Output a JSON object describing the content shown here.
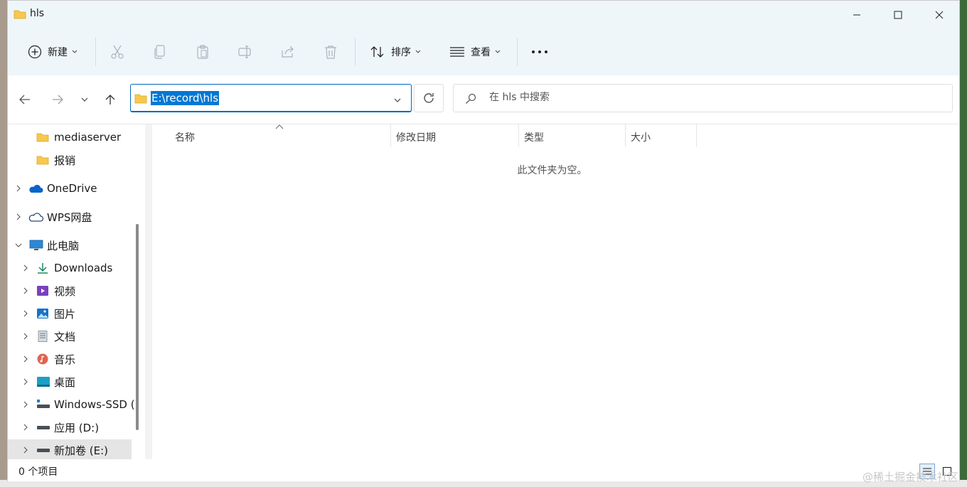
{
  "window": {
    "title": "hls"
  },
  "toolbar": {
    "new_label": "新建",
    "sort_label": "排序",
    "view_label": "查看"
  },
  "address": {
    "path": "E:\\record\\hls"
  },
  "search": {
    "placeholder": "在 hls 中搜索"
  },
  "sidebar": {
    "items": [
      {
        "label": "mediaserver",
        "icon": "folder-icon"
      },
      {
        "label": "报销",
        "icon": "folder-icon"
      },
      {
        "label": "OneDrive",
        "icon": "onedrive-icon"
      },
      {
        "label": "WPS网盘",
        "icon": "cloud-icon"
      },
      {
        "label": "此电脑",
        "icon": "computer-icon"
      },
      {
        "label": "Downloads",
        "icon": "download-icon"
      },
      {
        "label": "视频",
        "icon": "video-icon"
      },
      {
        "label": "图片",
        "icon": "picture-icon"
      },
      {
        "label": "文档",
        "icon": "document-icon"
      },
      {
        "label": "音乐",
        "icon": "music-icon"
      },
      {
        "label": "桌面",
        "icon": "desktop-icon"
      },
      {
        "label": "Windows-SSD (",
        "icon": "drive-icon"
      },
      {
        "label": "应用 (D:)",
        "icon": "drive-icon"
      },
      {
        "label": "新加卷 (E:)",
        "icon": "drive-icon"
      }
    ]
  },
  "columns": {
    "name": "名称",
    "modified": "修改日期",
    "type": "类型",
    "size": "大小"
  },
  "content": {
    "empty_message": "此文件夹为空。"
  },
  "status": {
    "item_count": "0 个项目"
  },
  "watermark": "@稀土掘金技术社区",
  "colors": {
    "accent": "#0067c0",
    "selection": "#0078d4",
    "toolbar_bg": "#eef6fa",
    "folder": "#f8c84a"
  }
}
